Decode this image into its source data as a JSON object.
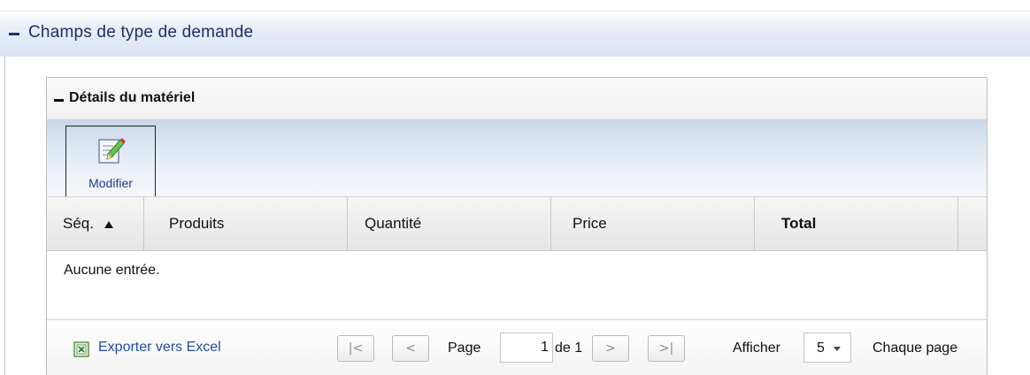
{
  "section": {
    "title": "Champs de type de demande"
  },
  "panel": {
    "title": "Détails du matériel"
  },
  "toolbar": {
    "modify_label": "Modifier"
  },
  "grid": {
    "columns": [
      "Séq.",
      "Produits",
      "Quantité",
      "Price",
      "Total"
    ],
    "sort_column": "Séq.",
    "sort_direction": "ascending",
    "empty_message": "Aucune entrée."
  },
  "footer": {
    "export_label": "Exporter vers Excel",
    "first_glyph": "|<",
    "prev_glyph": "<",
    "next_glyph": ">",
    "last_glyph": ">|",
    "page_label": "Page",
    "page_value": "1",
    "of_label": "de 1",
    "show_label": "Afficher",
    "page_size": "5",
    "per_page_label": "Chaque page"
  },
  "colors": {
    "link": "#1f4c9d",
    "section_title": "#1d2f6a",
    "toolbar_gradient_top": "#c9d7e8"
  }
}
